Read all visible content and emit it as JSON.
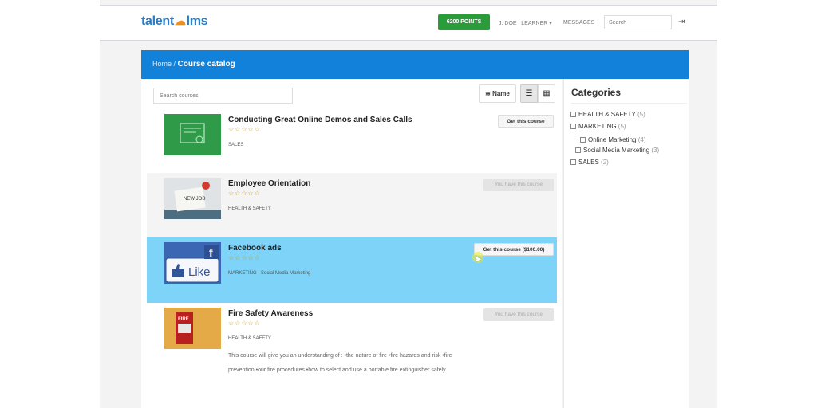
{
  "header": {
    "logo_left": "talent",
    "logo_right": "lms",
    "points_label": "6200 POINTS",
    "user_label": "J. DOE | LEARNER ▾",
    "messages_label": "MESSAGES",
    "search_placeholder": "Search"
  },
  "breadcrumb": {
    "home": "Home /",
    "current": "Course catalog"
  },
  "toolbar": {
    "search_placeholder": "Search courses",
    "sort_label": "Name"
  },
  "courses": [
    {
      "title": "Conducting Great Online Demos and Sales Calls",
      "rating": "☆☆☆☆☆",
      "category": "SALES",
      "action": "Get this course",
      "description": ""
    },
    {
      "title": "Employee Orientation",
      "rating": "☆☆☆☆☆",
      "category": "HEALTH & SAFETY",
      "action": "You have this course",
      "description": ""
    },
    {
      "title": "Facebook ads",
      "rating": "☆☆☆☆☆",
      "category": "MARKETING - Social Media Marketing",
      "action": "Get this course ($100.00)",
      "description": ""
    },
    {
      "title": "Fire Safety Awareness",
      "rating": "☆☆☆☆☆",
      "category": "HEALTH & SAFETY",
      "action": "You have this course",
      "description": "This course will give you an understanding of : •the nature of fire •fire hazards and risk •fire prevention •our fire procedures •how to select and use a portable fire extinguisher safely"
    }
  ],
  "thumb_texts": {
    "new_job": "NEW JOB",
    "like": "Like",
    "fb": "f",
    "fire": "FIRE"
  },
  "sidebar": {
    "title": "Categories",
    "items": [
      {
        "label": "HEALTH & SAFETY",
        "count": "(5)"
      },
      {
        "label": "MARKETING",
        "count": "(5)"
      },
      {
        "label": "Online Marketing",
        "count": "(4)"
      },
      {
        "label": "Social Media Marketing",
        "count": "(3)"
      },
      {
        "label": "SALES",
        "count": "(2)"
      }
    ]
  },
  "colors": {
    "brand_blue": "#1281d9",
    "points_green": "#2a9d3a",
    "highlight_row": "#7dd3f8"
  }
}
